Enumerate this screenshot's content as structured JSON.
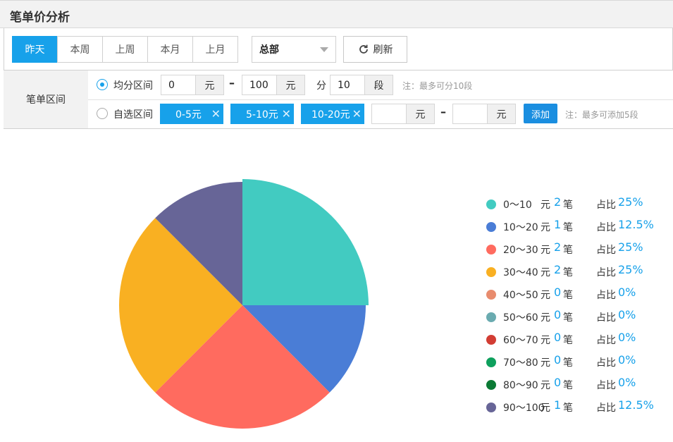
{
  "page": {
    "title": "笔单价分析"
  },
  "toolbar": {
    "tabs": [
      {
        "label": "昨天",
        "active": true
      },
      {
        "label": "本周"
      },
      {
        "label": "上周"
      },
      {
        "label": "本月"
      },
      {
        "label": "上月"
      }
    ],
    "store_select": "总部",
    "refresh_label": "刷新"
  },
  "ranges": {
    "section_label": "笔单区间",
    "equal": {
      "label": "均分区间",
      "from": "0",
      "to": "100",
      "unit": "元",
      "fen": "分",
      "segments": "10",
      "duan": "段",
      "note": "注：最多可分10段",
      "selected": true
    },
    "custom": {
      "label": "自选区间",
      "chips": [
        "0-5元",
        "5-10元",
        "10-20元"
      ],
      "from": "",
      "to": "",
      "unit": "元",
      "add_label": "添加",
      "note": "注：最多可添加5段",
      "selected": false
    }
  },
  "legend": [
    {
      "range": "0～10",
      "yuan": "元",
      "count": "2",
      "bi": "笔",
      "zb": "占比",
      "pct": "25%",
      "color": "#42cbc1"
    },
    {
      "range": "10～20",
      "yuan": "元",
      "count": "1",
      "bi": "笔",
      "zb": "占比",
      "pct": "12.5%",
      "color": "#4a7dd6"
    },
    {
      "range": "20～30",
      "yuan": "元",
      "count": "2",
      "bi": "笔",
      "zb": "占比",
      "pct": "25%",
      "color": "#ff6b5f"
    },
    {
      "range": "30～40",
      "yuan": "元",
      "count": "2",
      "bi": "笔",
      "zb": "占比",
      "pct": "25%",
      "color": "#f9b022"
    },
    {
      "range": "40～50",
      "yuan": "元",
      "count": "0",
      "bi": "笔",
      "zb": "占比",
      "pct": "0%",
      "color": "#e88c6e"
    },
    {
      "range": "50～60",
      "yuan": "元",
      "count": "0",
      "bi": "笔",
      "zb": "占比",
      "pct": "0%",
      "color": "#6aabb0"
    },
    {
      "range": "60～70",
      "yuan": "元",
      "count": "0",
      "bi": "笔",
      "zb": "占比",
      "pct": "0%",
      "color": "#d23d33"
    },
    {
      "range": "70～80",
      "yuan": "元",
      "count": "0",
      "bi": "笔",
      "zb": "占比",
      "pct": "0%",
      "color": "#0ea05d"
    },
    {
      "range": "80～90",
      "yuan": "元",
      "count": "0",
      "bi": "笔",
      "zb": "占比",
      "pct": "0%",
      "color": "#0b7a35"
    },
    {
      "range": "90～100",
      "yuan": "元",
      "count": "1",
      "bi": "笔",
      "zb": "占比",
      "pct": "12.5%",
      "color": "#676597"
    }
  ],
  "chart_data": {
    "type": "pie",
    "categories": [
      "0～10",
      "10～20",
      "20～30",
      "30～40",
      "40～50",
      "50～60",
      "60～70",
      "70～80",
      "80～90",
      "90～100"
    ],
    "values": [
      2,
      1,
      2,
      2,
      0,
      0,
      0,
      0,
      0,
      1
    ],
    "colors": [
      "#42cbc1",
      "#4a7dd6",
      "#ff6b5f",
      "#f9b022",
      "#e88c6e",
      "#6aabb0",
      "#d23d33",
      "#0ea05d",
      "#0b7a35",
      "#676597"
    ],
    "title": "",
    "legend_position": "right",
    "highlighted_index": 0
  }
}
